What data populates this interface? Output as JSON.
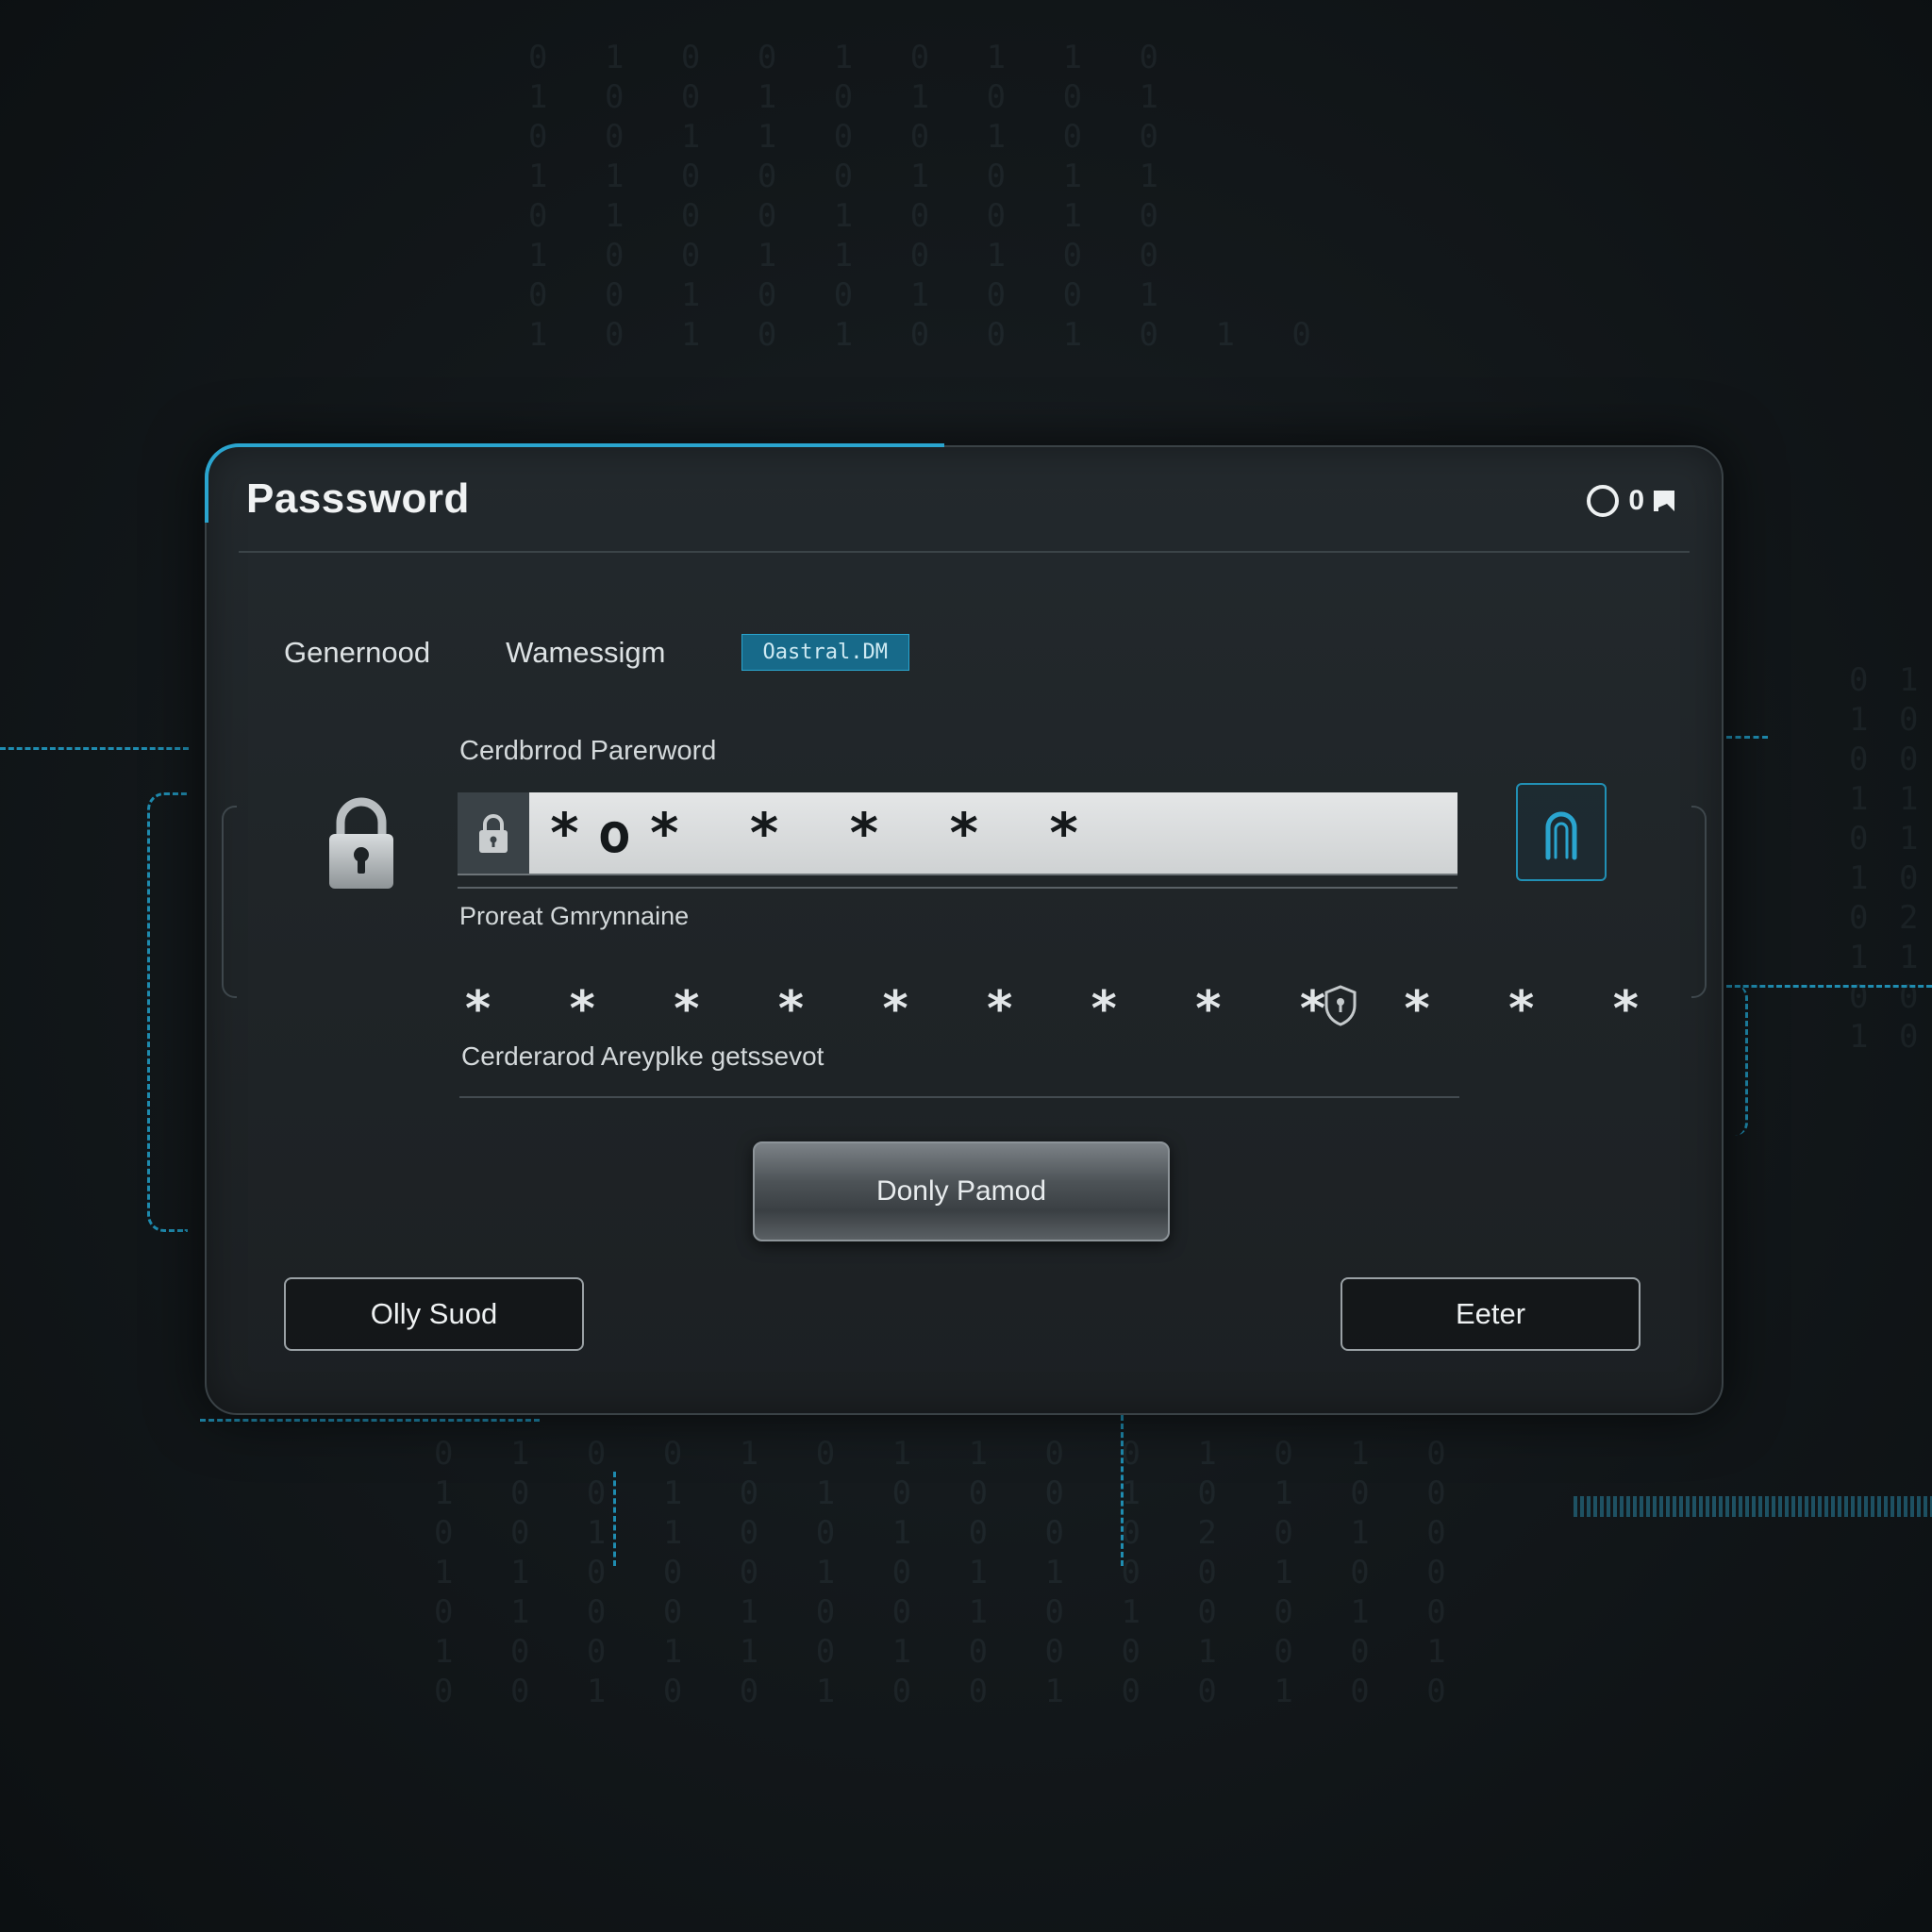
{
  "dialog": {
    "title": "Passsword",
    "title_controls": {
      "text": "0"
    }
  },
  "tabs": [
    {
      "label": "Genernood"
    },
    {
      "label": "Wamessigm"
    },
    {
      "label": "Oastral.DM",
      "active": true
    }
  ],
  "password_field": {
    "label": "Cerdbrrod Parerword",
    "value": "*o* * * * *",
    "helper": "Proreat Gmrynnaine"
  },
  "generated": {
    "stars": "* * * * * * * * * * * *",
    "caption": "Cerderarod Areyplke getssevot"
  },
  "buttons": {
    "primary": "Donly Pamod",
    "left": "Olly Suod",
    "right": "Eeter"
  },
  "icons": {
    "lock_large": "lock-icon",
    "lock_small": "lock-icon",
    "key": "keyhole-icon",
    "shield": "shield-icon",
    "window_control": "circle-icon"
  },
  "colors": {
    "accent": "#2aa5cf",
    "active_tab": "#176a8a",
    "dialog_bg": "#1f2427",
    "page_bg": "#121619"
  },
  "background": {
    "digits_top": "0 1 0 0 1 0 1 1 0\n1 0 0 1 0 1 0 0 1\n0 0 1 1 0 0 1 0 0\n1 1 0 0 0 1 0 1 1\n0 1 0 0 1 0 0 1 0\n1 0 0 1 1 0 1 0 0\n0 0 1 0 0 1 0 0 1\n1 0 1 0 1 0 0 1 0 1 0",
    "digits_bottom": "0 1 0 0 1 0 1 1 0 0 1 0 1 0\n1 0 0 1 0 1 0 0 0 1 0 1 0 0\n0 0 1 1 0 0 1 0 0 0 2 0 1 0\n1 1 0 0 0 1 0 1 1 0 0 1 0 0\n0 1 0 0 1 0 0 1 0 1 0 0 1 0\n1 0 0 1 1 0 1 0 0 0 1 0 0 1\n0 0 1 0 0 1 0 0 1 0 0 1 0 0",
    "digits_right": "0 1\n1 0\n0 0\n1 1\n0 1\n1 0\n0 2\n1 1\n0 0\n1 0"
  }
}
